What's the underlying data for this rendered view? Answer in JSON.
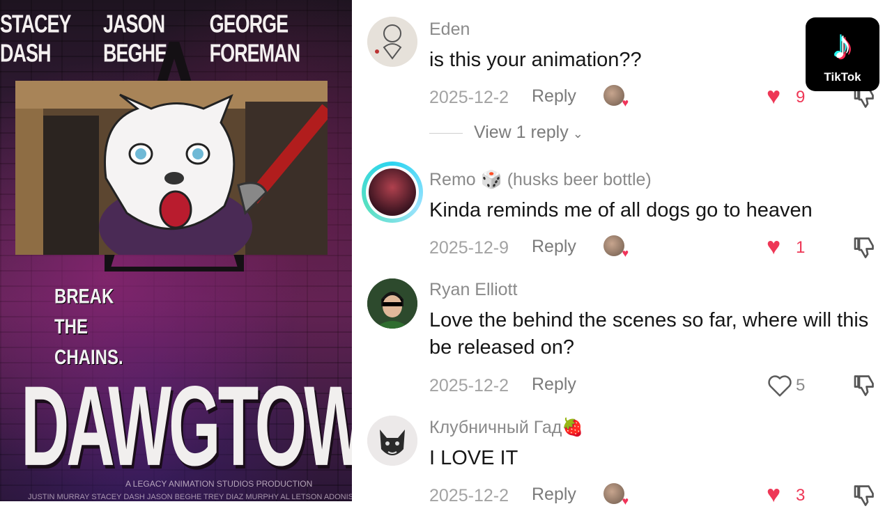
{
  "poster": {
    "credits": [
      "STACEY DASH",
      "JASON BEGHE",
      "GEORGE FOREMAN"
    ],
    "tagline": [
      "BREAK",
      "THE",
      "CHAINS."
    ],
    "title": "DAWGTOWN",
    "studio": "A LEGACY ANIMATION STUDIOS PRODUCTION",
    "billing": "JUSTIN MURRAY   STACEY DASH   JASON BEGHE   TREY DIAZ MURPHY   AL LETSON   ADONIS BOYD   DAVIDON MONROE"
  },
  "badge": {
    "label": "TikTok"
  },
  "comments": [
    {
      "username": "Eden",
      "text": "is this your animation??",
      "date": "2025-12-2",
      "reply_label": "Reply",
      "likes": "9",
      "liked": true,
      "view_replies": "View 1 reply"
    },
    {
      "username": "Remo 🎲 (husks beer bottle)",
      "text": "Kinda reminds me of all dogs go to heaven",
      "date": "2025-12-9",
      "reply_label": "Reply",
      "likes": "1",
      "liked": true
    },
    {
      "username": "Ryan Elliott",
      "text": "Love the behind the scenes so far, where will this be released on?",
      "date": "2025-12-2",
      "reply_label": "Reply",
      "likes": "5",
      "liked": false
    },
    {
      "username": "Клубничный Гад🍓",
      "text": "I LOVE IT",
      "date": "2025-12-2",
      "reply_label": "Reply",
      "likes": "3",
      "liked": true
    }
  ],
  "colors": {
    "like_red": "#ee3756",
    "meta_gray": "#a3a3a3",
    "text_dark": "#161616"
  }
}
